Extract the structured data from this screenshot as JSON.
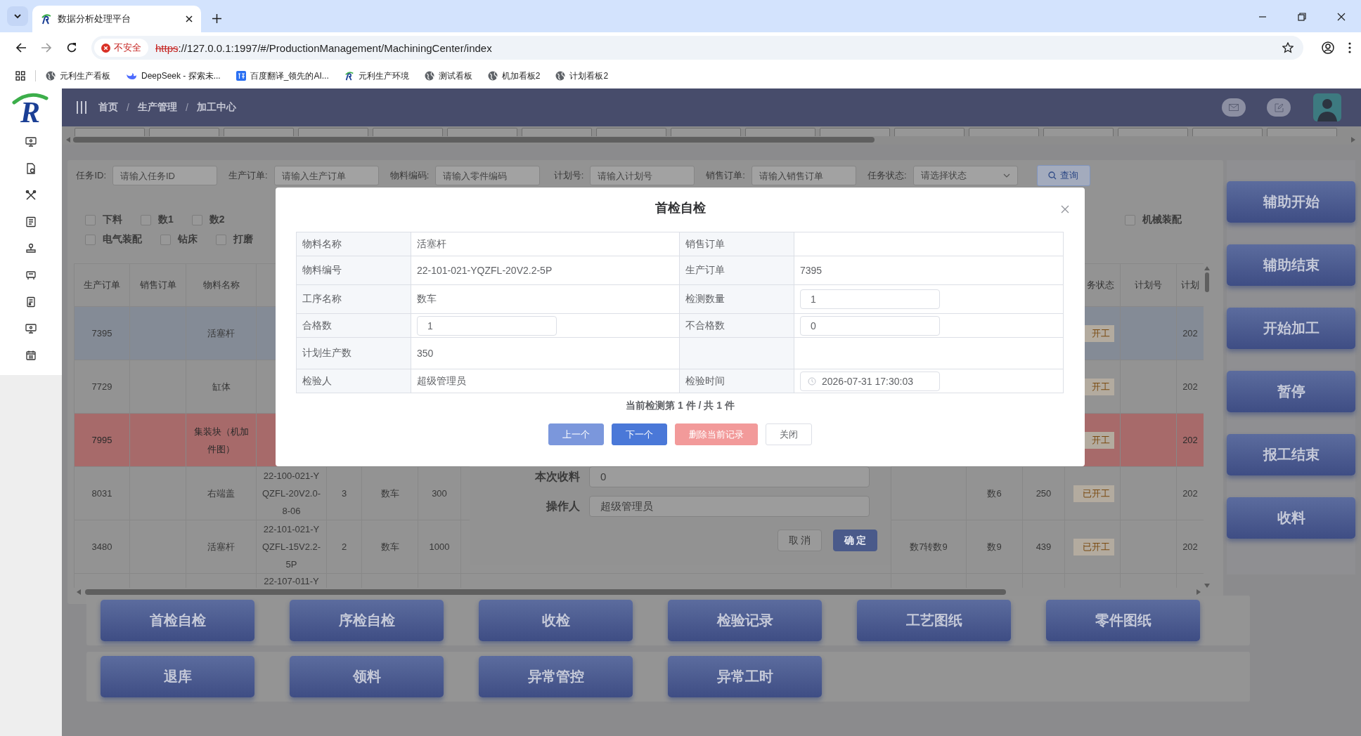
{
  "browser": {
    "tabs": [
      {
        "title": "数据分析处理平台",
        "selected": true
      }
    ],
    "security": "不安全",
    "url_scheme": "https",
    "url_rest": "://127.0.0.1:1997/#/ProductionManagement/MachiningCenter/index",
    "bookmarks": [
      {
        "label": "元利生产看板",
        "kind": "globe"
      },
      {
        "label": "DeepSeek - 探索未...",
        "kind": "whale"
      },
      {
        "label": "百度翻译_领先的AI...",
        "kind": "translate"
      },
      {
        "label": "元利生产环境",
        "kind": "logo"
      },
      {
        "label": "测试看板",
        "kind": "globe"
      },
      {
        "label": "机加看板2",
        "kind": "globe"
      },
      {
        "label": "计划看板2",
        "kind": "globe"
      }
    ]
  },
  "sidebar": {
    "logo": "R"
  },
  "header": {
    "breadcrumb": [
      "首页",
      "生产管理",
      "加工中心"
    ],
    "separator": "/"
  },
  "filters": [
    {
      "label": "任务ID:",
      "placeholder": "请输入任务ID",
      "kind": "input"
    },
    {
      "label": "生产订单:",
      "placeholder": "请输入生产订单",
      "kind": "input"
    },
    {
      "label": "物料编码:",
      "placeholder": "请输入零件编码",
      "kind": "input"
    },
    {
      "label": "计划号:",
      "placeholder": "请输入计划号",
      "kind": "input"
    },
    {
      "label": "销售订单:",
      "placeholder": "请输入销售订单",
      "kind": "input"
    },
    {
      "label": "任务状态:",
      "placeholder": "请选择状态",
      "kind": "select"
    }
  ],
  "search_button": "查询",
  "checkbox_rows": [
    {
      "left": [
        {
          "label": "下料",
          "checked": false
        },
        {
          "label": "数1",
          "checked": false
        },
        {
          "label": "数2",
          "checked": false
        }
      ],
      "right": [
        {
          "label": "机械装配",
          "checked": false
        }
      ]
    },
    {
      "left": [
        {
          "label": "电气装配",
          "checked": false
        },
        {
          "label": "钻床",
          "checked": false
        },
        {
          "label": "打磨",
          "checked": false
        }
      ]
    }
  ],
  "table": {
    "columns": [
      "生产订单",
      "销售订单",
      "物料名称",
      null,
      null,
      null,
      null,
      null,
      null,
      null,
      null,
      "务状态",
      "计划号",
      "计划"
    ],
    "rows": [
      {
        "selected": true,
        "abnormal": false,
        "cells": [
          "7395",
          null,
          "活塞杆",
          null,
          null,
          null,
          null,
          null,
          null,
          null,
          null,
          "开工",
          null,
          "202"
        ]
      },
      {
        "selected": false,
        "abnormal": false,
        "cells": [
          "7729",
          null,
          "缸体",
          null,
          null,
          null,
          null,
          null,
          null,
          null,
          null,
          "开工",
          null,
          "202"
        ]
      },
      {
        "selected": false,
        "abnormal": true,
        "cells": [
          "7995",
          null,
          "集装块（机加件图）",
          null,
          null,
          null,
          null,
          null,
          null,
          null,
          null,
          "开工",
          null,
          "202"
        ]
      },
      {
        "selected": false,
        "abnormal": false,
        "cells": [
          "8031",
          null,
          "右端盖",
          "22-100-021-YQZFL-20V2.0-8-06",
          "3",
          "数车",
          "300",
          null,
          null,
          "数6",
          "250",
          "已开工",
          null,
          "202"
        ]
      },
      {
        "selected": false,
        "abnormal": false,
        "cells": [
          "3480",
          null,
          "活塞杆",
          "22-101-021-YQZFL-15V2.2-5P",
          "2",
          "数车",
          "1000",
          null,
          "数7转数9",
          "数9",
          "439",
          "已开工",
          null,
          "202"
        ]
      },
      {
        "selected": false,
        "abnormal": false,
        "cells": [
          null,
          null,
          null,
          "22-107-011-Y",
          null,
          null,
          null,
          null,
          null,
          null,
          null,
          null,
          null,
          null
        ]
      }
    ]
  },
  "side_actions": [
    "辅助开始",
    "辅助结束",
    "开始加工",
    "暂停",
    "报工结束",
    "收料"
  ],
  "bottom_actions": [
    [
      "首检自检",
      "序检自检",
      "收检",
      "检验记录",
      "工艺图纸",
      "零件图纸"
    ],
    [
      "退库",
      "领料",
      "异常管控",
      "异常工时"
    ]
  ],
  "receive_dialog": {
    "fields": [
      {
        "label": "本次收料",
        "value": "0"
      },
      {
        "label": "操作人",
        "value": "超级管理员"
      }
    ],
    "buttons": [
      {
        "label": "取 消",
        "primary": false
      },
      {
        "label": "确 定",
        "primary": true
      }
    ]
  },
  "modal": {
    "title": "首检自检",
    "rows": [
      [
        {
          "kind": "label",
          "text": "物料名称"
        },
        {
          "kind": "text",
          "text": "活塞杆"
        },
        {
          "kind": "label",
          "text": "销售订单"
        },
        {
          "kind": "text"
        }
      ],
      [
        {
          "kind": "label",
          "text": "物料编号"
        },
        {
          "kind": "text",
          "text": "22-101-021-YQZFL-20V2.2-5P"
        },
        {
          "kind": "label",
          "text": "生产订单"
        },
        {
          "kind": "text",
          "text": "7395"
        }
      ],
      [
        {
          "kind": "label",
          "text": "工序名称"
        },
        {
          "kind": "text",
          "text": "数车"
        },
        {
          "kind": "label",
          "text": "检测数量"
        },
        {
          "kind": "input",
          "text": "1"
        }
      ],
      [
        {
          "kind": "label",
          "text": "合格数"
        },
        {
          "kind": "input",
          "text": "1"
        },
        {
          "kind": "label",
          "text": "不合格数"
        },
        {
          "kind": "input",
          "text": "0"
        }
      ],
      [
        {
          "kind": "label",
          "text": "计划生产数"
        },
        {
          "kind": "text",
          "text": "350"
        },
        {
          "kind": "label"
        },
        {
          "kind": "text"
        }
      ],
      [
        {
          "kind": "label",
          "text": "检验人"
        },
        {
          "kind": "text",
          "text": "超级管理员"
        },
        {
          "kind": "label",
          "text": "检验时间"
        },
        {
          "kind": "datetime",
          "text": "2026-07-31 17:30:03"
        }
      ]
    ],
    "progress": "当前检测第 1 件 / 共 1 件",
    "buttons": [
      {
        "label": "上一个",
        "kind": "primary",
        "disabled": true
      },
      {
        "label": "下一个",
        "kind": "primary",
        "disabled": false
      },
      {
        "label": "删除当前记录",
        "kind": "danger",
        "disabled": true
      },
      {
        "label": "关闭",
        "kind": "default",
        "disabled": false
      }
    ]
  }
}
